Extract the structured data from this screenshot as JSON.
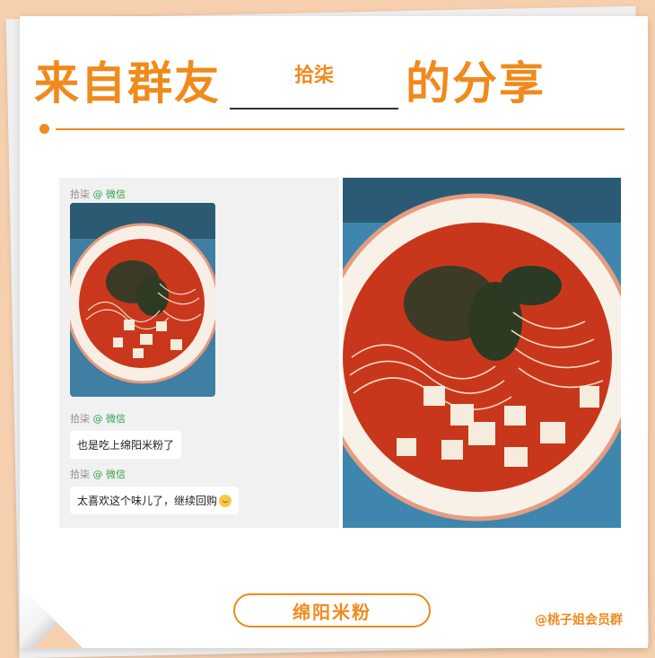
{
  "header": {
    "title_left": "来自群友",
    "member_name": "拾柒",
    "title_right": "的分享"
  },
  "chat": {
    "messages": [
      {
        "sender": "拾柒",
        "platform": "@ 微信",
        "type": "image"
      },
      {
        "sender": "拾柒",
        "platform": "@ 微信",
        "text": "也是吃上绵阳米粉了"
      },
      {
        "sender": "拾柒",
        "platform": "@ 微信",
        "text": "太喜欢这个味儿了，继续回购"
      }
    ]
  },
  "footer": {
    "tag": "绵阳米粉",
    "credit": "@桃子姐会员群"
  },
  "colors": {
    "accent": "#f08a1c",
    "background": "#f6cfae",
    "wechat_green": "#35a24a"
  }
}
